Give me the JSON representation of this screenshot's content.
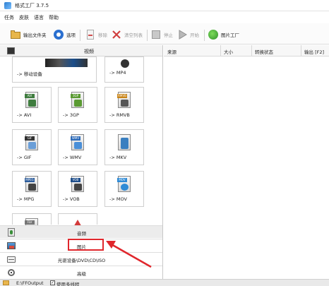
{
  "window": {
    "title": "格式工厂 3.7.5"
  },
  "menu": [
    "任务",
    "皮肤",
    "语言",
    "帮助"
  ],
  "toolbar": {
    "output_folder": "输出文件夹",
    "options": "选项",
    "remove": "移除",
    "clear_list": "清空列表",
    "stop": "停止",
    "start": "开始",
    "image_factory": "图片工厂"
  },
  "left_panel": {
    "header": "视频",
    "partial_tiles": [
      {
        "label": "-> 移动设备",
        "icon": "mobile-devices-icon"
      },
      {
        "label": "-> MP4",
        "icon": "mp4-icon"
      }
    ],
    "tiles": [
      {
        "label": "-> AVI",
        "badge": "AVI",
        "icon": "avi-icon",
        "color": "#3f7d3f"
      },
      {
        "label": "-> 3GP",
        "badge": "3GP",
        "icon": "3gp-icon",
        "color": "#5a9a32"
      },
      {
        "label": "-> RMVB",
        "badge": "RMVB",
        "icon": "rmvb-icon",
        "color": "#c88418"
      },
      {
        "label": "-> GIF",
        "badge": "GIF",
        "icon": "gif-icon",
        "color": "#333333"
      },
      {
        "label": "-> WMV",
        "badge": "WMV",
        "icon": "wmv-icon",
        "color": "#2e6bb8"
      },
      {
        "label": "-> MKV",
        "badge": "",
        "icon": "mkv-icon",
        "color": "#3a7fc0"
      },
      {
        "label": "-> MPG",
        "badge": "MPEG",
        "icon": "mpg-icon",
        "color": "#2d5d9c"
      },
      {
        "label": "-> VOB",
        "badge": "VOB",
        "icon": "vob-icon",
        "color": "#1f4f8c"
      },
      {
        "label": "-> MOV",
        "badge": "MOV",
        "icon": "mov-icon",
        "color": "#2f8bd6"
      }
    ],
    "bottom_tiles": [
      {
        "badge": "FLV",
        "icon": "flv-icon",
        "color": "#777777"
      },
      {
        "badge": "",
        "icon": "swf-icon",
        "color": "#d33a3a"
      }
    ],
    "categories": [
      {
        "label": "音频",
        "icon": "audio-icon"
      },
      {
        "label": "图片",
        "icon": "image-icon"
      },
      {
        "label": "光驱设备\\DVD\\CD\\ISO",
        "icon": "optical-drive-icon"
      },
      {
        "label": "高级",
        "icon": "advanced-icon"
      }
    ]
  },
  "task_table": {
    "columns": [
      "来源",
      "大小",
      "转换状态",
      "输出 [F2]"
    ]
  },
  "status": {
    "output_path": "E:\\FFOutput",
    "multithread_label": "使用多线程",
    "multithread_checked": true
  },
  "accent_colors": {
    "highlight": "#e0262c"
  }
}
